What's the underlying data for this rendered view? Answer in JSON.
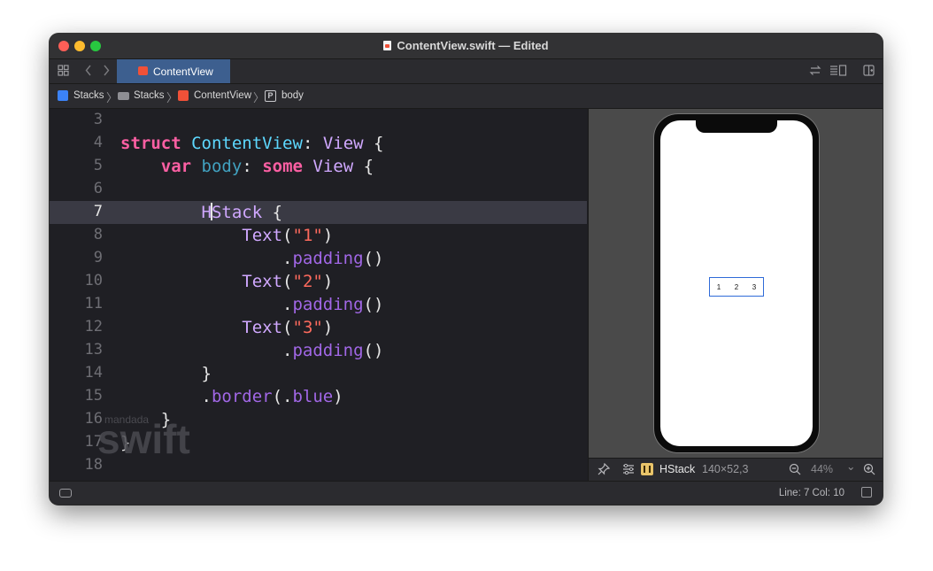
{
  "window": {
    "title": "ContentView.swift — Edited"
  },
  "tabbar": {
    "active_tab": "ContentView",
    "icons": [
      "grid-icon",
      "back-icon",
      "forward-icon",
      "swap-icon",
      "inspector-layout-icon",
      "add-editor-icon"
    ]
  },
  "breadcrumb": {
    "items": [
      "Stacks",
      "Stacks",
      "ContentView",
      "body"
    ],
    "icons": [
      "app-icon",
      "folder-icon",
      "swift-icon",
      "property-icon"
    ],
    "property_glyph": "P"
  },
  "editor": {
    "lines": [
      {
        "n": "3"
      },
      {
        "n": "4"
      },
      {
        "n": "5"
      },
      {
        "n": "6"
      },
      {
        "n": "7"
      },
      {
        "n": "8"
      },
      {
        "n": "9"
      },
      {
        "n": "10"
      },
      {
        "n": "11"
      },
      {
        "n": "12"
      },
      {
        "n": "13"
      },
      {
        "n": "14"
      },
      {
        "n": "15"
      },
      {
        "n": "16"
      },
      {
        "n": "17"
      },
      {
        "n": "18"
      }
    ],
    "current_line": "7",
    "watermark_small": "mandada",
    "watermark_big": "swift"
  },
  "preview": {
    "hstack_items": [
      "1",
      "2",
      "3"
    ],
    "border_color": "#2f6bd8",
    "toolbar": {
      "selection_name": "HStack",
      "selection_size": "140×52,3",
      "zoom": "44%",
      "zoom_arrow": "⌄"
    }
  },
  "statusbar": {
    "position": "Line: 7  Col: 10"
  },
  "colors": {
    "keyword": "#fc5fa3",
    "type": "#5dd8ff",
    "method": "#a167e6",
    "string": "#fc6a5d",
    "tab_active": "#3d5f8f"
  }
}
